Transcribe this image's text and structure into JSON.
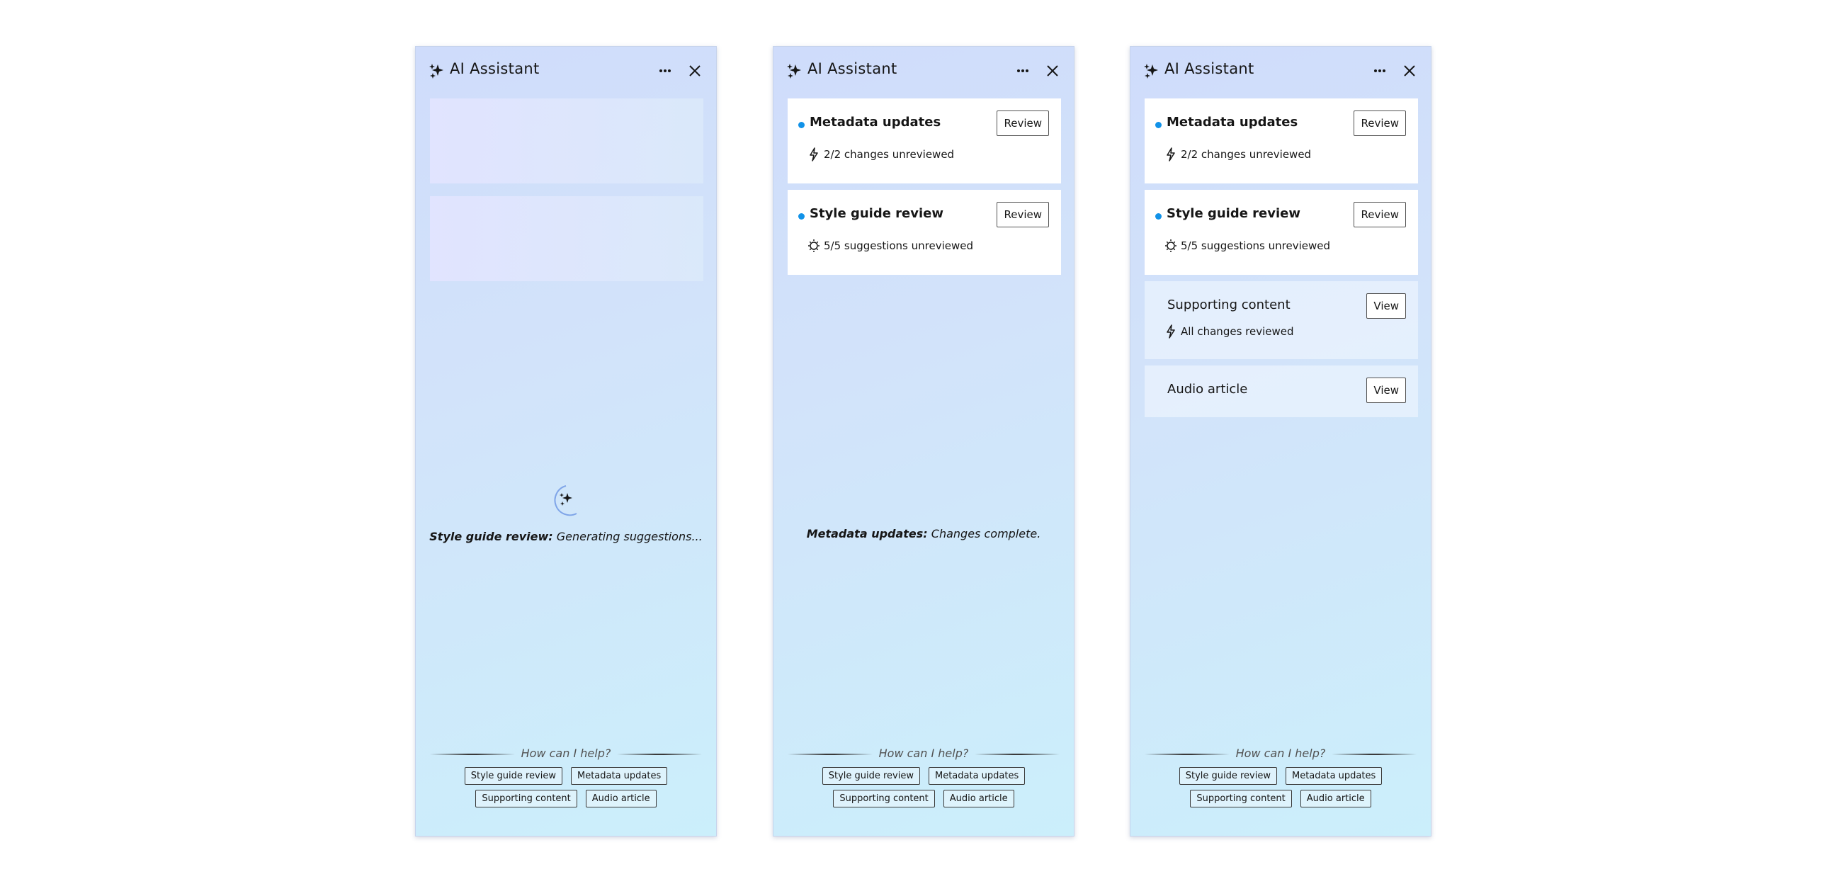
{
  "app": {
    "title": "AI Assistant"
  },
  "icons": {
    "app": "sparkle-icon",
    "more": "overflow-menu-icon",
    "close": "close-icon",
    "changes": "lightning-icon",
    "suggestions": "lightbulb-icon"
  },
  "colors": {
    "accent_dot": "#1192e8",
    "panel_gradient_start": "#cfdcfb",
    "panel_gradient_end": "#cbeffb"
  },
  "panels": [
    {
      "state": "loading",
      "status_label": "Style guide review:",
      "status_text": "Generating suggestions..."
    },
    {
      "state": "complete",
      "status_label": "Metadata updates:",
      "status_text": "Changes complete.",
      "cards": [
        {
          "title": "Metadata updates",
          "button": "Review",
          "icon": "lightning-icon",
          "detail": "2/2 changes unreviewed"
        },
        {
          "title": "Style guide review",
          "button": "Review",
          "icon": "lightbulb-icon",
          "detail": "5/5 suggestions unreviewed"
        }
      ]
    },
    {
      "state": "all",
      "cards": [
        {
          "title": "Metadata updates",
          "button": "Review",
          "icon": "lightning-icon",
          "detail": "2/2 changes unreviewed"
        },
        {
          "title": "Style guide review",
          "button": "Review",
          "icon": "lightbulb-icon",
          "detail": "5/5 suggestions unreviewed"
        },
        {
          "title": "Supporting content",
          "button": "View",
          "icon": "lightning-icon",
          "detail": "All changes reviewed"
        },
        {
          "title": "Audio article",
          "button": "View"
        }
      ]
    }
  ],
  "prompt": {
    "question": "How can I help?",
    "chips": [
      "Style guide review",
      "Metadata updates",
      "Supporting content",
      "Audio article"
    ]
  }
}
